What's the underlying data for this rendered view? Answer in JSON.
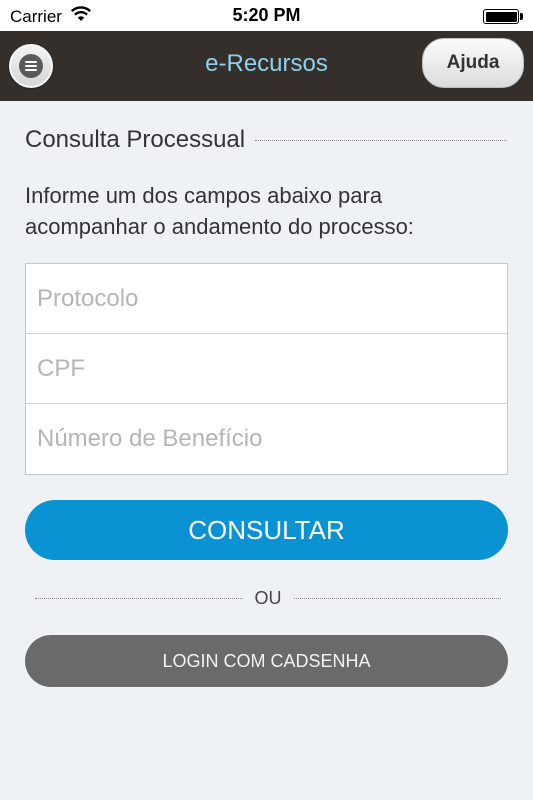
{
  "status_bar": {
    "carrier": "Carrier",
    "time": "5:20 PM"
  },
  "nav": {
    "title": "e-Recursos",
    "help_label": "Ajuda",
    "title_color": "#8fd0ea",
    "bar_color": "#342f2b"
  },
  "section": {
    "title": "Consulta Processual",
    "instructions": "Informe um dos campos abaixo para acompanhar o andamento do processo:"
  },
  "form": {
    "fields": [
      {
        "placeholder": "Protocolo"
      },
      {
        "placeholder": "CPF"
      },
      {
        "placeholder": "Número de Benefício"
      }
    ]
  },
  "actions": {
    "consult_label": "CONSULTAR",
    "consult_color": "#0993d3",
    "or_label": "OU",
    "login_label": "LOGIN COM CADSENHA",
    "login_color": "#6a6a6a"
  }
}
